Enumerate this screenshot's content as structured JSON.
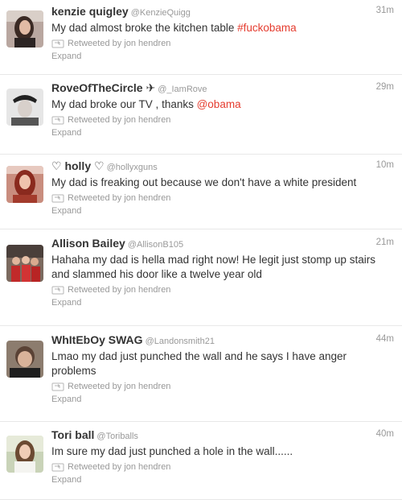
{
  "tweets": [
    {
      "fullname": "kenzie quigley",
      "username": "@KenzieQuigg",
      "time": "31m",
      "text_before": "My dad almost broke the kitchen table ",
      "highlight": "#fuckobama",
      "text_after": "",
      "retweeted_by": "Retweeted by jon hendren",
      "expand": "Expand",
      "avatar_icon": "avatar-photo-icon"
    },
    {
      "fullname": "RoveOfTheCircle ✈",
      "username": "@_IamRove",
      "time": "29m",
      "text_before": "My dad broke our TV , thanks ",
      "highlight": "@obama",
      "text_after": "",
      "retweeted_by": "Retweeted by jon hendren",
      "expand": "Expand",
      "avatar_icon": "avatar-photo-icon"
    },
    {
      "fullname": "♡ holly ♡",
      "username": "@hollyxguns",
      "time": "10m",
      "text_before": "My dad is freaking out because we don't have a white president",
      "highlight": "",
      "text_after": "",
      "retweeted_by": "Retweeted by jon hendren",
      "expand": "Expand",
      "avatar_icon": "avatar-photo-icon"
    },
    {
      "fullname": "Allison Bailey",
      "username": "@AllisonB105",
      "time": "21m",
      "text_before": "Hahaha my dad is hella mad right now! He legit just stomp up stairs and slammed his door like a twelve year old",
      "highlight": "",
      "text_after": "",
      "retweeted_by": "Retweeted by jon hendren",
      "expand": "Expand",
      "avatar_icon": "avatar-photo-icon"
    },
    {
      "fullname": "WhItEbOy SWAG",
      "username": "@Landonsmith21",
      "time": "44m",
      "text_before": "Lmao my dad just punched the wall and he says I have anger problems",
      "highlight": "",
      "text_after": "",
      "retweeted_by": "Retweeted by jon hendren",
      "expand": "Expand",
      "avatar_icon": "avatar-photo-icon"
    },
    {
      "fullname": "Tori ball",
      "username": "@Toriballs",
      "time": "40m",
      "text_before": "Im sure my dad just punched a hole in the wall......",
      "highlight": "",
      "text_after": "",
      "retweeted_by": "Retweeted by jon hendren",
      "expand": "Expand",
      "avatar_icon": "avatar-photo-icon"
    }
  ],
  "colors": {
    "highlight": "#e53c2f",
    "muted": "#999999",
    "text": "#333333",
    "divider": "#e8e8e8"
  }
}
